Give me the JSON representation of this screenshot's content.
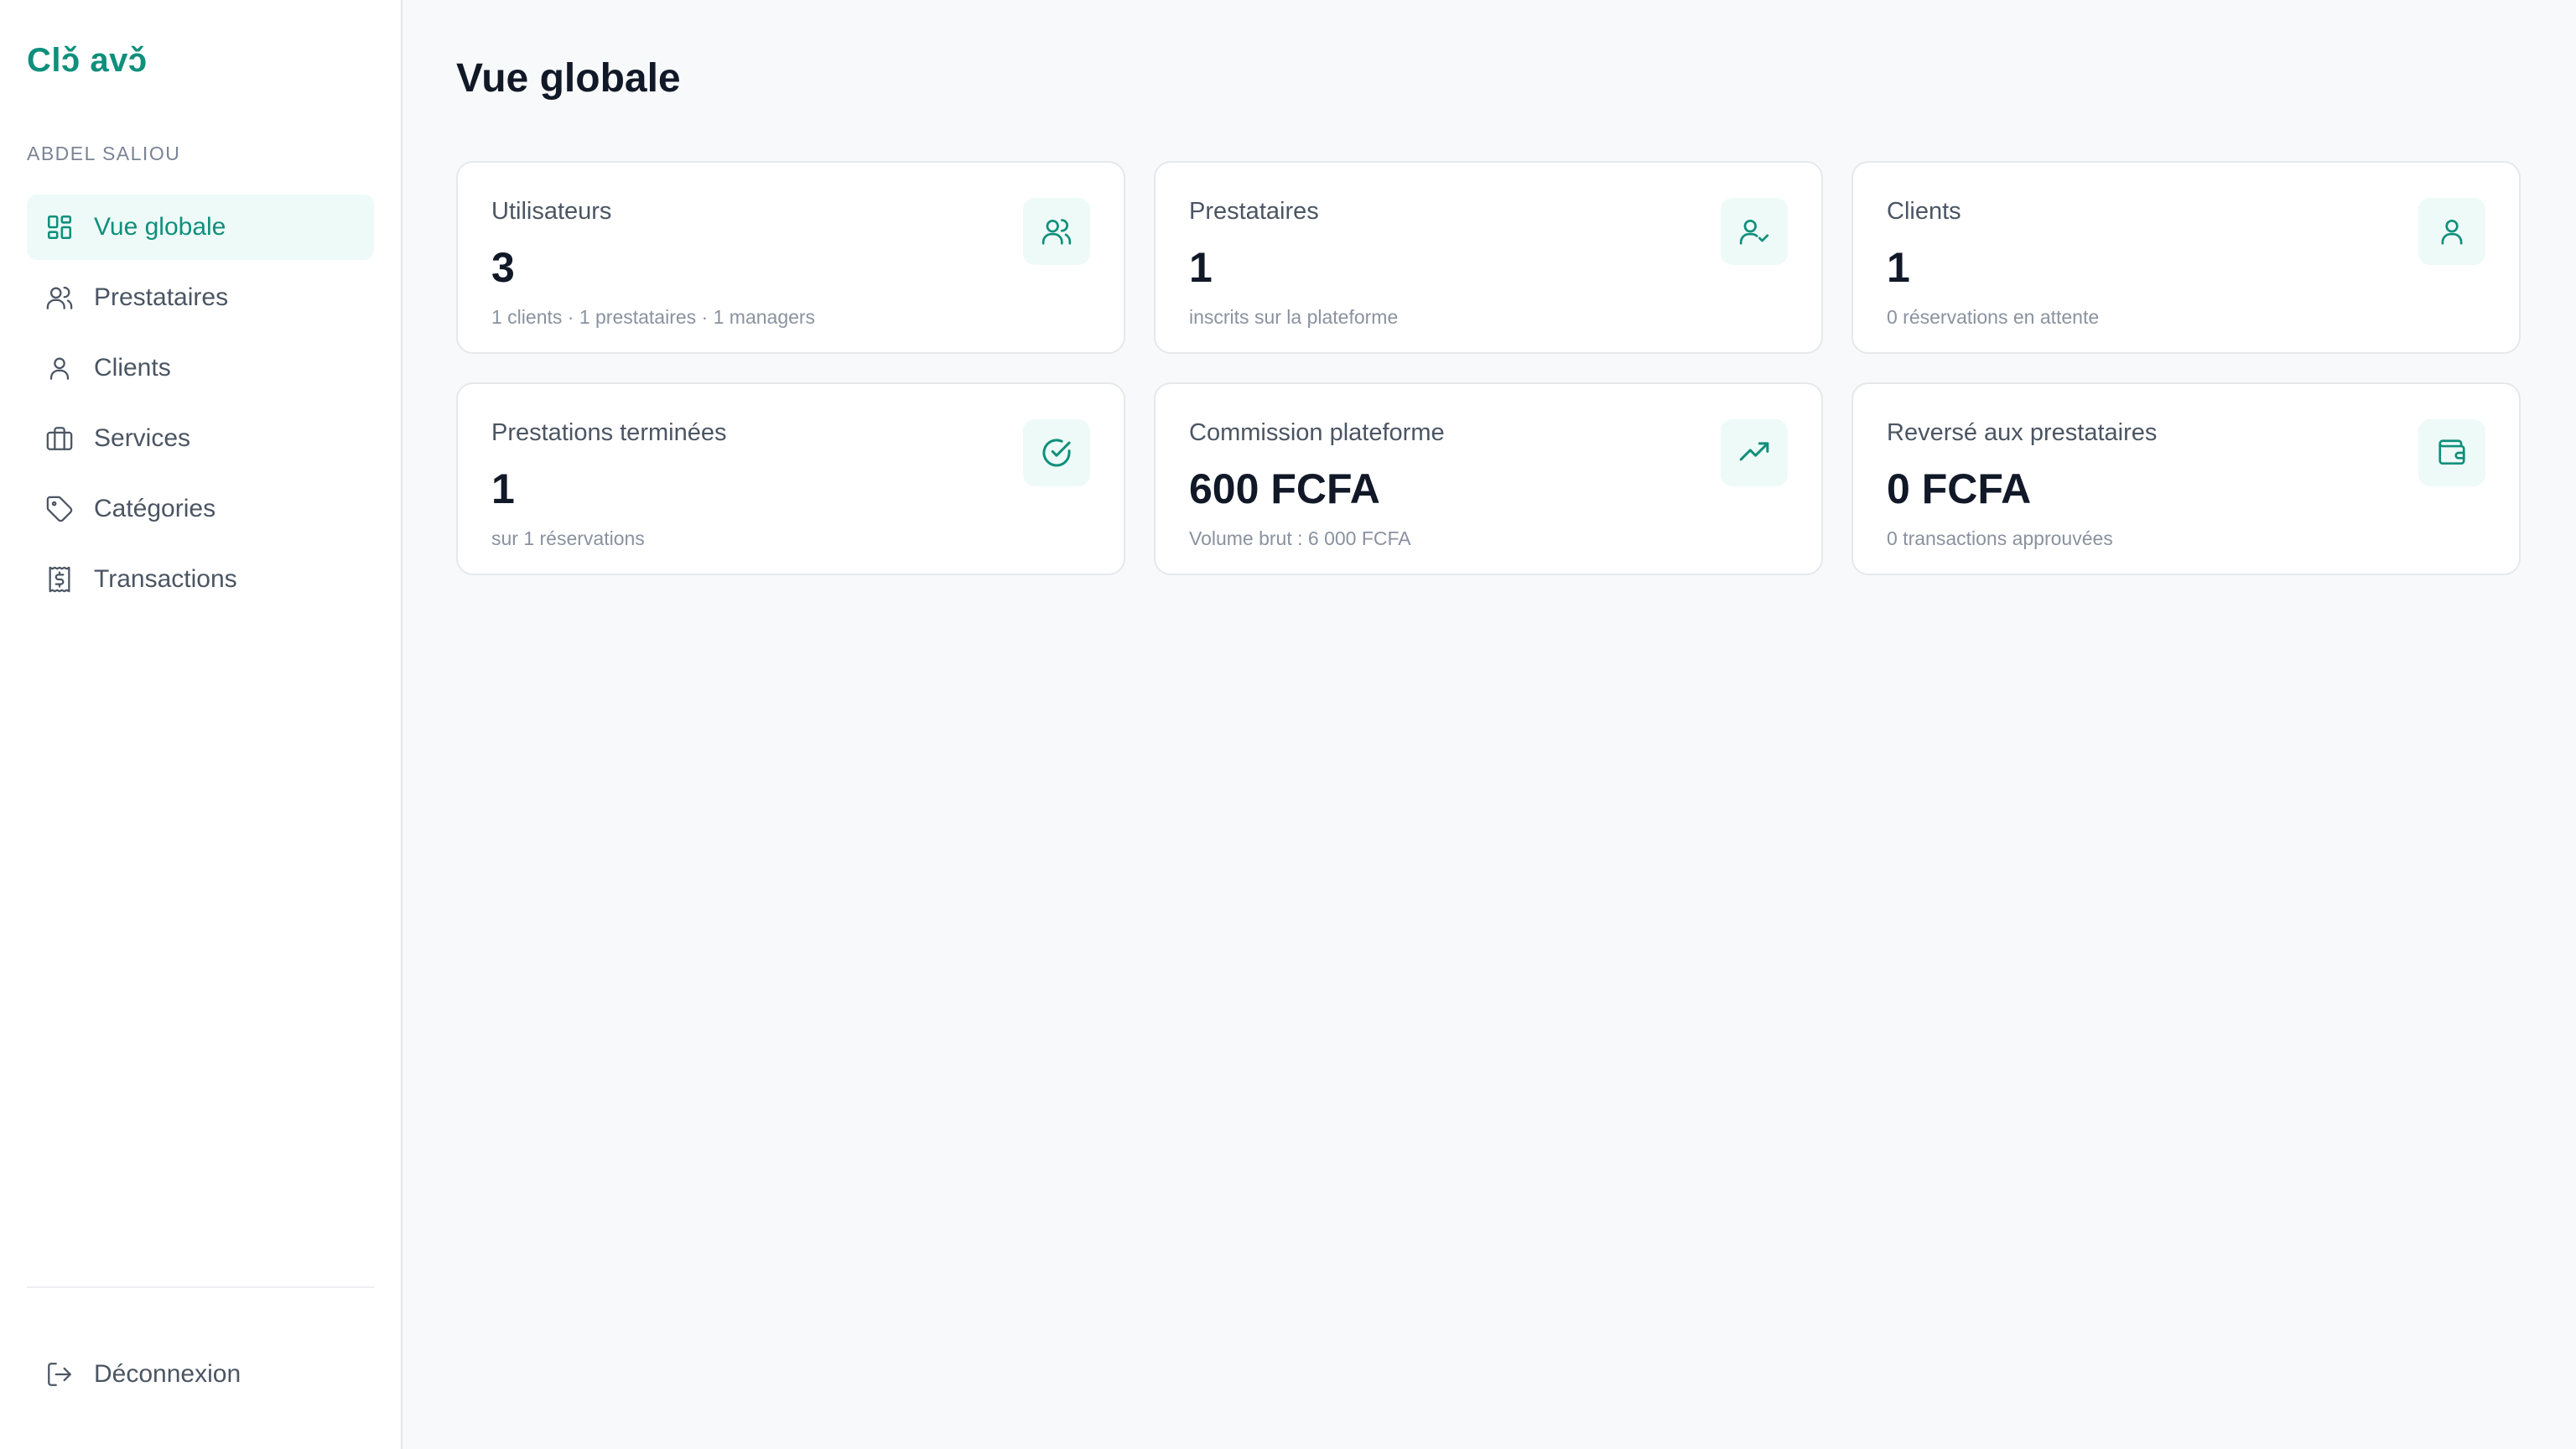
{
  "app": {
    "brand": "Clɔ̌ avɔ̌"
  },
  "sidebar": {
    "user_name": "ABDEL SALIOU",
    "items": [
      {
        "label": "Vue globale",
        "icon": "dashboard-icon",
        "active": true
      },
      {
        "label": "Prestataires",
        "icon": "users-icon",
        "active": false
      },
      {
        "label": "Clients",
        "icon": "user-icon",
        "active": false
      },
      {
        "label": "Services",
        "icon": "briefcase-icon",
        "active": false
      },
      {
        "label": "Catégories",
        "icon": "tag-icon",
        "active": false
      },
      {
        "label": "Transactions",
        "icon": "receipt-icon",
        "active": false
      }
    ],
    "logout_label": "Déconnexion"
  },
  "main": {
    "title": "Vue globale",
    "cards": [
      {
        "label": "Utilisateurs",
        "value": "3",
        "sub": "1 clients · 1 prestataires · 1 managers",
        "icon": "users-icon"
      },
      {
        "label": "Prestataires",
        "value": "1",
        "sub": "inscrits sur la plateforme",
        "icon": "user-check-icon"
      },
      {
        "label": "Clients",
        "value": "1",
        "sub": "0 réservations en attente",
        "icon": "user-icon"
      },
      {
        "label": "Prestations terminées",
        "value": "1",
        "sub": "sur 1 réservations",
        "icon": "check-circle-icon"
      },
      {
        "label": "Commission plateforme",
        "value": "600 FCFA",
        "sub": "Volume brut : 6 000 FCFA",
        "icon": "trending-up-icon"
      },
      {
        "label": "Reversé aux prestataires",
        "value": "0 FCFA",
        "sub": "0 transactions approuvées",
        "icon": "wallet-icon"
      }
    ]
  },
  "colors": {
    "accent": "#0f8f7c",
    "accent_bg": "#eefaf7",
    "page_bg": "#f8f9fb"
  }
}
